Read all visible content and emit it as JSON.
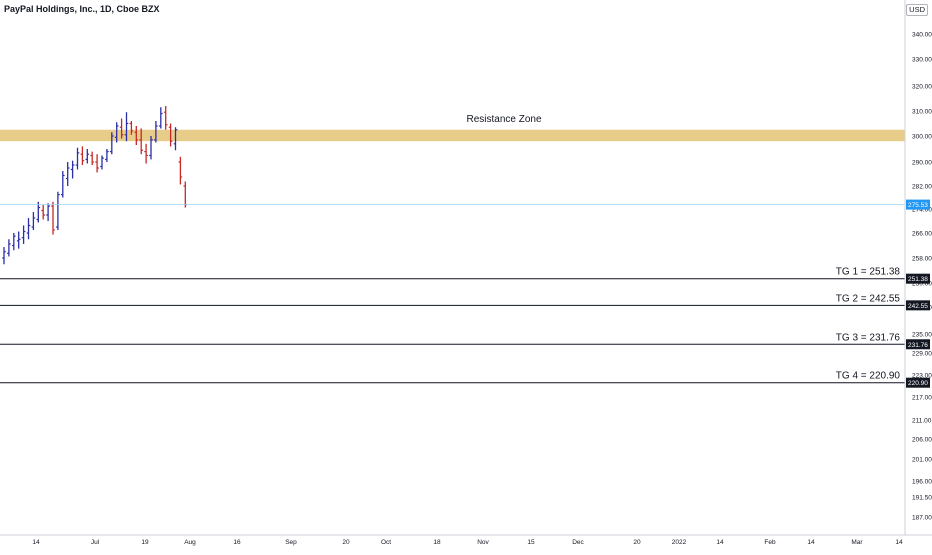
{
  "header": {
    "symbol_title": "PayPal Holdings, Inc., 1D, Cboe BZX",
    "currency": "USD"
  },
  "chart_data": {
    "type": "ohlc",
    "title": "PayPal Holdings, Inc., 1D, Cboe BZX",
    "currency": "USD",
    "ylim": [
      184,
      352
    ],
    "y_ticks": [
      "187.00",
      "191.50",
      "196.00",
      "201.00",
      "206.00",
      "211.00",
      "217.00",
      "223.00",
      "229.00",
      "235.00",
      "242.00",
      "250.00",
      "258.00",
      "266.00",
      "274.00",
      "282.00",
      "290.00",
      "300.00",
      "310.00",
      "320.00",
      "330.00",
      "340.00"
    ],
    "x_ticks": [
      "14",
      "Jul",
      "19",
      "Aug",
      "16",
      "Sep",
      "20",
      "Oct",
      "18",
      "Nov",
      "15",
      "Dec",
      "20",
      "2022",
      "14",
      "Feb",
      "14",
      "Mar",
      "14"
    ],
    "bars": [
      {
        "o": 258.0,
        "h": 261.5,
        "l": 256.0,
        "c": 260.0
      },
      {
        "o": 259.5,
        "h": 264.0,
        "l": 258.5,
        "c": 262.5
      },
      {
        "o": 262.0,
        "h": 266.0,
        "l": 260.5,
        "c": 265.0
      },
      {
        "o": 263.5,
        "h": 266.5,
        "l": 261.0,
        "c": 264.0
      },
      {
        "o": 264.5,
        "h": 268.5,
        "l": 262.5,
        "c": 266.5
      },
      {
        "o": 266.0,
        "h": 271.0,
        "l": 264.0,
        "c": 268.5
      },
      {
        "o": 268.0,
        "h": 273.0,
        "l": 267.0,
        "c": 271.0
      },
      {
        "o": 270.5,
        "h": 276.5,
        "l": 269.5,
        "c": 274.5
      },
      {
        "o": 273.5,
        "h": 275.5,
        "l": 270.5,
        "c": 272.0
      },
      {
        "o": 272.0,
        "h": 276.0,
        "l": 270.0,
        "c": 275.0
      },
      {
        "o": 275.0,
        "h": 276.5,
        "l": 265.5,
        "c": 267.0
      },
      {
        "o": 268.0,
        "h": 280.0,
        "l": 267.0,
        "c": 279.0
      },
      {
        "o": 279.0,
        "h": 287.0,
        "l": 278.0,
        "c": 285.5
      },
      {
        "o": 284.5,
        "h": 290.0,
        "l": 282.0,
        "c": 288.0
      },
      {
        "o": 287.5,
        "h": 290.5,
        "l": 284.5,
        "c": 289.0
      },
      {
        "o": 289.0,
        "h": 295.5,
        "l": 287.5,
        "c": 293.5
      },
      {
        "o": 293.0,
        "h": 296.0,
        "l": 289.0,
        "c": 290.5
      },
      {
        "o": 291.0,
        "h": 295.0,
        "l": 289.5,
        "c": 293.0
      },
      {
        "o": 292.5,
        "h": 294.0,
        "l": 289.0,
        "c": 290.0
      },
      {
        "o": 290.0,
        "h": 293.0,
        "l": 286.5,
        "c": 288.0
      },
      {
        "o": 288.5,
        "h": 292.5,
        "l": 287.5,
        "c": 291.5
      },
      {
        "o": 291.0,
        "h": 295.0,
        "l": 290.0,
        "c": 294.0
      },
      {
        "o": 294.0,
        "h": 301.5,
        "l": 293.0,
        "c": 300.0
      },
      {
        "o": 299.5,
        "h": 305.5,
        "l": 297.5,
        "c": 304.0
      },
      {
        "o": 303.5,
        "h": 307.0,
        "l": 299.0,
        "c": 300.5
      },
      {
        "o": 300.5,
        "h": 309.5,
        "l": 298.0,
        "c": 305.0
      },
      {
        "o": 305.0,
        "h": 306.0,
        "l": 300.5,
        "c": 302.0
      },
      {
        "o": 301.5,
        "h": 304.0,
        "l": 296.5,
        "c": 298.5
      },
      {
        "o": 298.5,
        "h": 303.0,
        "l": 293.0,
        "c": 294.5
      },
      {
        "o": 294.0,
        "h": 297.0,
        "l": 289.5,
        "c": 292.5
      },
      {
        "o": 292.5,
        "h": 300.0,
        "l": 291.0,
        "c": 298.5
      },
      {
        "o": 298.5,
        "h": 306.0,
        "l": 297.5,
        "c": 304.0
      },
      {
        "o": 304.0,
        "h": 311.5,
        "l": 303.0,
        "c": 309.0
      },
      {
        "o": 309.5,
        "h": 312.0,
        "l": 302.5,
        "c": 304.5
      },
      {
        "o": 303.5,
        "h": 305.0,
        "l": 296.0,
        "c": 298.0
      },
      {
        "o": 297.0,
        "h": 303.5,
        "l": 294.5,
        "c": 302.5
      },
      {
        "o": 290.0,
        "h": 292.0,
        "l": 282.5,
        "c": 285.0
      },
      {
        "o": 282.0,
        "h": 283.5,
        "l": 274.5,
        "c": 275.5
      }
    ],
    "bar_colors": {
      "up": "#2a2ea8",
      "down": "#c62828"
    },
    "resistance_zone": {
      "label": "Resistance Zone",
      "from": 298.0,
      "to": 302.5,
      "color": "#e8cd8a"
    },
    "current_price": {
      "label": "275.53",
      "value": 275.53,
      "color": "#2196f3"
    },
    "targets": [
      {
        "label": "TG 1 = 251.38",
        "tag": "251.38",
        "value": 251.38
      },
      {
        "label": "TG 2 = 242.55",
        "tag": "242.55",
        "value": 242.55
      },
      {
        "label": "TG 3 = 231.76",
        "tag": "231.76",
        "value": 231.76
      },
      {
        "label": "TG 4 = 220.90",
        "tag": "220.90",
        "value": 220.9
      }
    ]
  }
}
